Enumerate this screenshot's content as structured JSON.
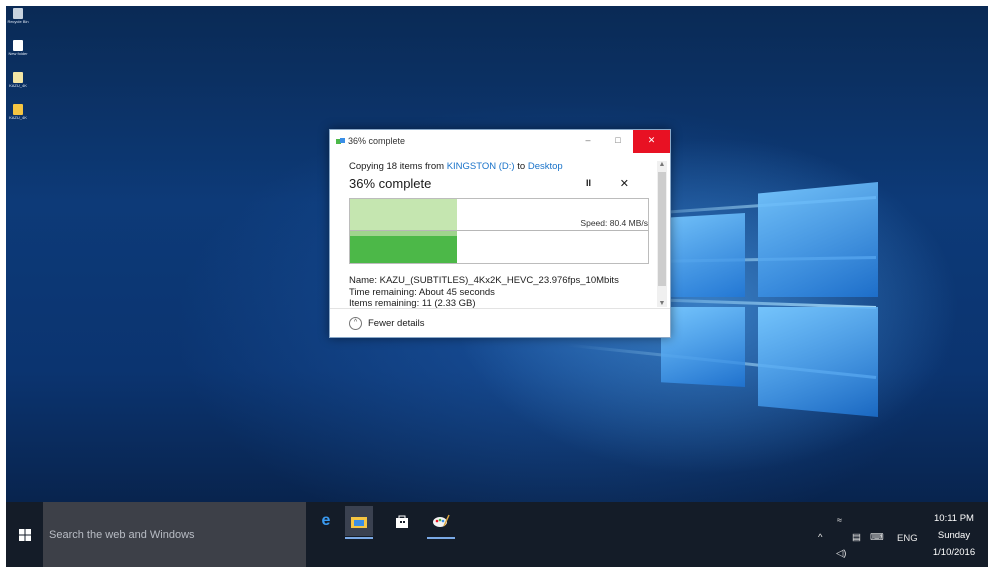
{
  "desktop": {
    "icons": [
      {
        "name": "recycle-bin",
        "label": "Recycle Bin"
      },
      {
        "name": "new-folder",
        "label": "New folder"
      },
      {
        "name": "file-item",
        "label": "KAZU_4K"
      },
      {
        "name": "folder-item",
        "label": "KAZU_4K"
      }
    ]
  },
  "dialog": {
    "title": "36% complete",
    "copy_prefix": "Copying 18 items from",
    "source": "KINGSTON (D:)",
    "copy_to": "to",
    "destination": "Desktop",
    "heading": "36% complete",
    "progress_percent": 36,
    "speed": "Speed: 80.4 MB/s",
    "name_line": "Name: KAZU_(SUBTITLES)_4Kx2K_HEVC_23.976fps_10Mbits",
    "time_line": "Time remaining: About 45 seconds",
    "items_line": "Items remaining: 11 (2.33 GB)",
    "fewer_details": "Fewer details",
    "minimize_glyph": "–",
    "maximize_glyph": "□",
    "pause_glyph": "II",
    "cancel_glyph": "✕",
    "accent": "#e81123",
    "graph_fill": "#4cb848"
  },
  "taskbar": {
    "search_placeholder": "Search the web and Windows",
    "apps": [
      "edge-icon",
      "file-explorer-icon",
      "store-icon",
      "paint-icon"
    ],
    "tray": {
      "chevron": "^",
      "language": "ENG"
    },
    "clock": {
      "time": "10:11 PM",
      "day": "Sunday",
      "date": "1/10/2016"
    }
  }
}
